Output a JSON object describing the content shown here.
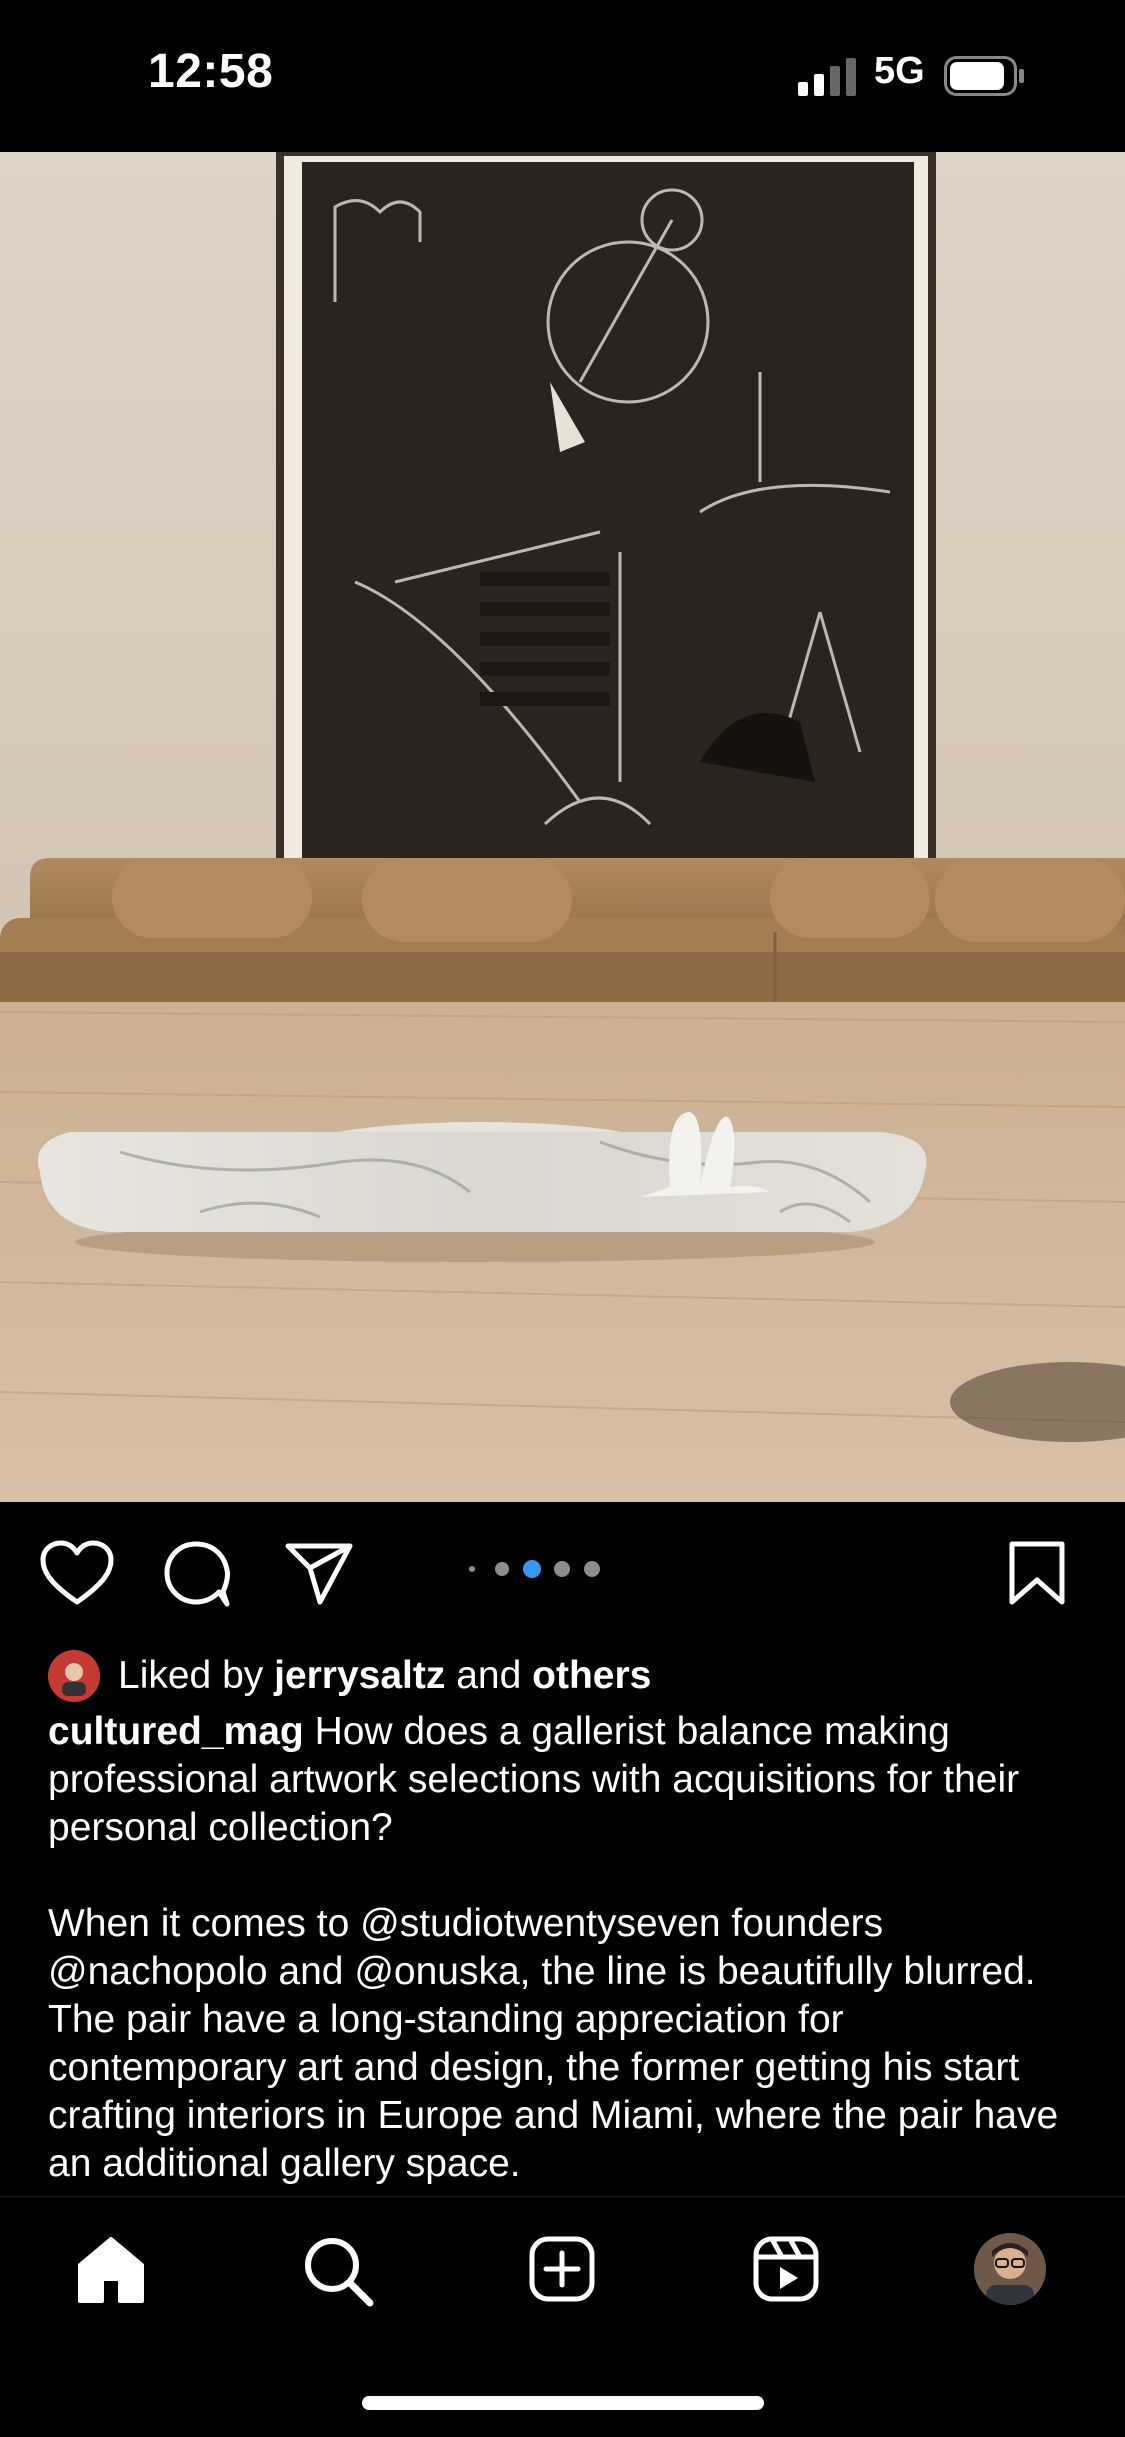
{
  "status_bar": {
    "time": "12:58",
    "network": "5G",
    "icons": [
      "signal-icon",
      "battery-icon"
    ]
  },
  "post": {
    "image_alt_icon": "photo",
    "carousel": {
      "count": 5,
      "active_index": 2
    },
    "likes": {
      "prefix": "Liked by",
      "user": "jerrysaltz",
      "joiner": "and",
      "others": "others"
    },
    "caption": {
      "username": "cultured_mag",
      "text1": "How does a gallerist balance making professional artwork selections with acquisitions for their personal collection?",
      "text2": "When it comes to @studiotwentyseven founders @nachopolo and @onuska, the line is beautifully blurred. The pair have a long-standing appreciation for contemporary art and design, the former getting his start crafting interiors in Europe and Miami, where the pair have an additional gallery space."
    },
    "actions": [
      "heart-icon",
      "comment-icon",
      "share-icon",
      "bookmark-icon"
    ]
  },
  "tabbar": {
    "items": [
      "home-icon",
      "search-icon",
      "create-icon",
      "reels-icon",
      "profile-avatar"
    ]
  },
  "colors": {
    "background": "#000000",
    "text": "#ffffff",
    "carousel_active": "#3897f0",
    "carousel_inactive": "#8e8e8e"
  }
}
